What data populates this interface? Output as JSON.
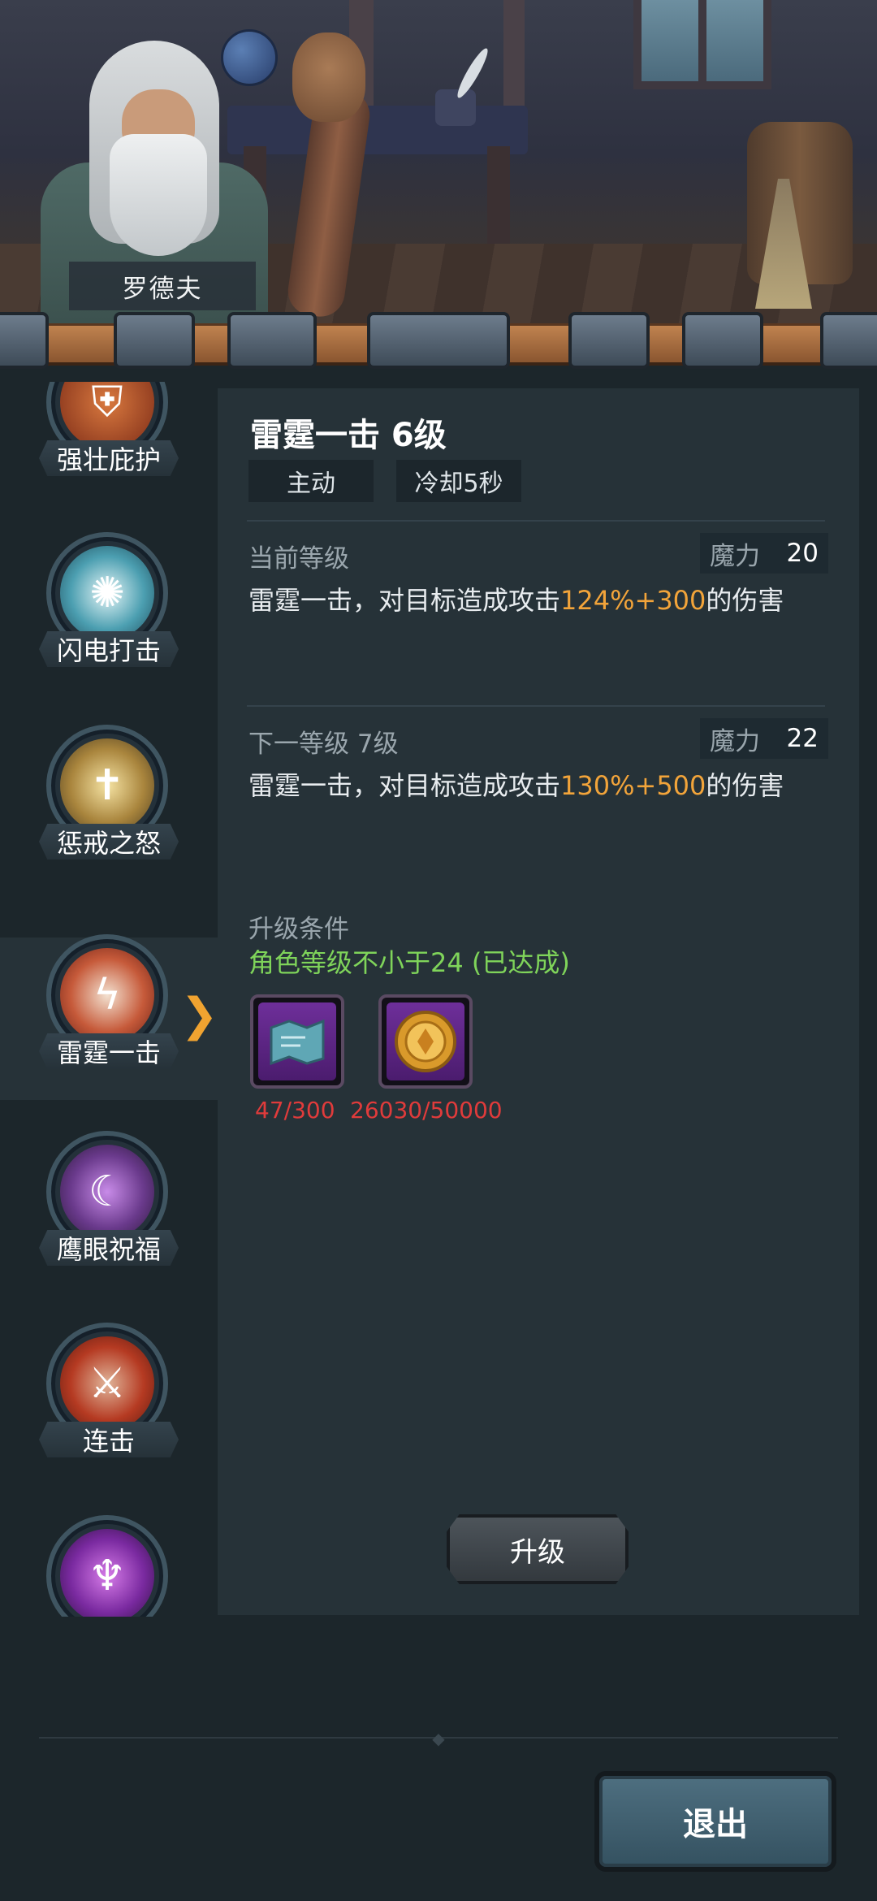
{
  "npc": {
    "name": "罗德夫"
  },
  "skills": [
    {
      "label": "强壮庇护",
      "icon": "shield-rock-icon",
      "color": "#b54a2a"
    },
    {
      "label": "闪电打击",
      "icon": "lightning-orb-icon",
      "color": "#6fb6c4"
    },
    {
      "label": "惩戒之怒",
      "icon": "holy-sword-icon",
      "color": "#9a7a3e"
    },
    {
      "label": "雷霆一击",
      "icon": "thunder-strike-icon",
      "color": "#c04a33"
    },
    {
      "label": "鹰眼祝福",
      "icon": "moon-eye-icon",
      "color": "#6a3a8c"
    },
    {
      "label": "连击",
      "icon": "crossed-axes-icon",
      "color": "#b53a22"
    },
    {
      "label": "",
      "icon": "demon-icon",
      "color": "#7a2aa0"
    }
  ],
  "detail": {
    "title": "雷霆一击 6级",
    "tag_type": "主动",
    "tag_cooldown": "冷却5秒",
    "current": {
      "head": "当前等级",
      "mana_label": "魔力",
      "mana_value": "20",
      "desc_pre": "雷霆一击，对目标造成攻击",
      "desc_hl": "124%+300",
      "desc_post": "的伤害"
    },
    "next": {
      "head": "下一等级 7级",
      "mana_label": "魔力",
      "mana_value": "22",
      "desc_pre": "雷霆一击，对目标造成攻击",
      "desc_hl": "130%+500",
      "desc_post": "的伤害"
    },
    "condition_title": "升级条件",
    "condition_text": "角色等级不小于24 (已达成)",
    "materials": [
      {
        "icon": "scroll-map-icon",
        "count": "47/300"
      },
      {
        "icon": "gold-coin-icon",
        "count": "26030/50000"
      }
    ],
    "upgrade_label": "升级"
  },
  "exit_label": "退出",
  "colors": {
    "highlight": "#f2a43a",
    "condition_met": "#7fd45a",
    "insufficient": "#e03b3b"
  }
}
